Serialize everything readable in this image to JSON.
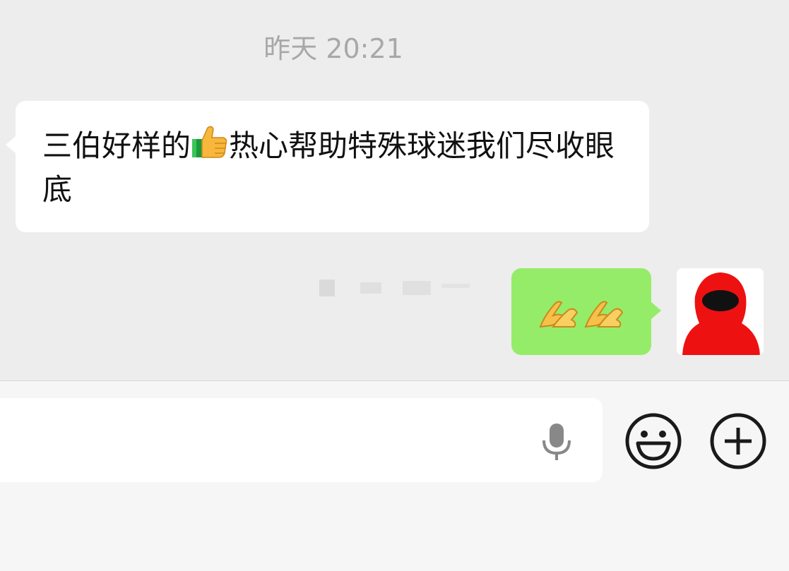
{
  "chat": {
    "timestamp": "昨天 20:21",
    "incoming": {
      "text_before": "三伯好样的",
      "emoji": "thumbs-up",
      "text_after": "热心帮助特殊球迷我们尽收眼底"
    },
    "outgoing": {
      "emoji": [
        "praying-hands",
        "praying-hands"
      ]
    }
  },
  "input": {
    "mic_icon": "microphone-icon",
    "emoji_icon": "smiley-face-icon",
    "plus_icon": "plus-icon"
  },
  "colors": {
    "background": "#ededed",
    "incoming_bubble": "#ffffff",
    "outgoing_bubble": "#95ec69",
    "avatar_red": "#ee1111"
  }
}
